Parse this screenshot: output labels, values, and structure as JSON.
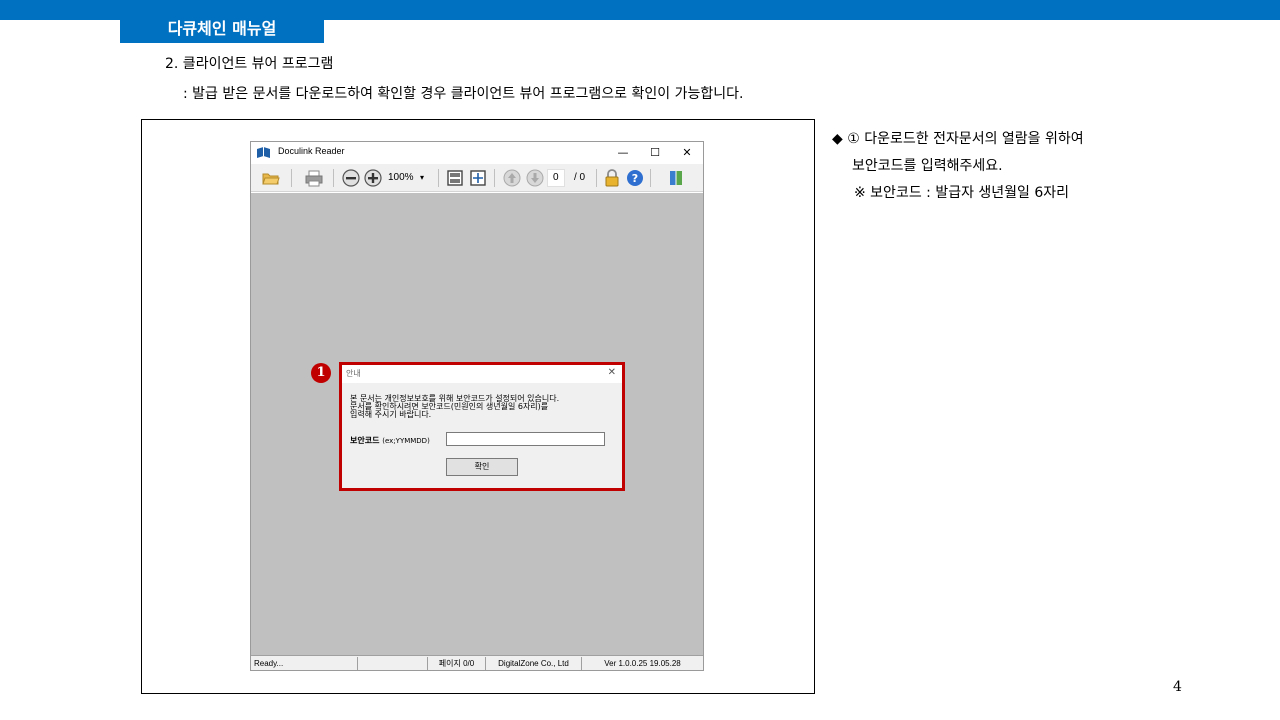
{
  "header": {
    "title": "다큐체인 매뉴얼",
    "bar_color": "#0070c0"
  },
  "section": {
    "heading": "2. 클라이언트 뷰어 프로그램",
    "description": ": 발급 받은 문서를 다운로드하여 확인할 경우 클라이언트 뷰어 프로그램으로 확인이 가능합니다."
  },
  "viewer": {
    "window_title": "Doculink Reader",
    "controls": {
      "minimize": "—",
      "maximize": "☐",
      "close": "✕"
    },
    "toolbar": {
      "icons": [
        "open-folder-icon",
        "print-icon",
        "zoom-out-icon",
        "zoom-in-icon",
        "fit-page-icon",
        "fit-width-icon",
        "prev-page-icon",
        "next-page-icon",
        "lock-icon",
        "help-icon",
        "exit-icon"
      ],
      "zoom": "100%",
      "zoom_arrow": "▾",
      "current_page": "0",
      "total_pages": "/ 0"
    },
    "status": {
      "ready": "Ready...",
      "page": "페이지 0/0",
      "company": "DigitalZone Co., Ltd",
      "version": "Ver 1.0.0.25   19.05.28"
    }
  },
  "dialog": {
    "marker": "1",
    "title": "안내",
    "close": "✕",
    "message_line1": "본 문서는 개인정보보호를 위해 보안코드가 설정되어 있습니다.",
    "message_line2": "문서를 확인하시려면 보안코드(민원인의 생년월일 6자리)를",
    "message_line3": "입력해 주시기 바랍니다.",
    "field_label": "보안코드",
    "field_hint": "(ex;YYMMDD)",
    "input_value": "",
    "ok_button": "확인",
    "outline_color": "#c00000"
  },
  "sidenote": {
    "line1": "◆ ① 다운로드한 전자문서의 열람을 위하여",
    "line2": "보안코드를 입력해주세요.",
    "line3": "※ 보안코드 : 발급자 생년월일 6자리"
  },
  "page_number": "4"
}
